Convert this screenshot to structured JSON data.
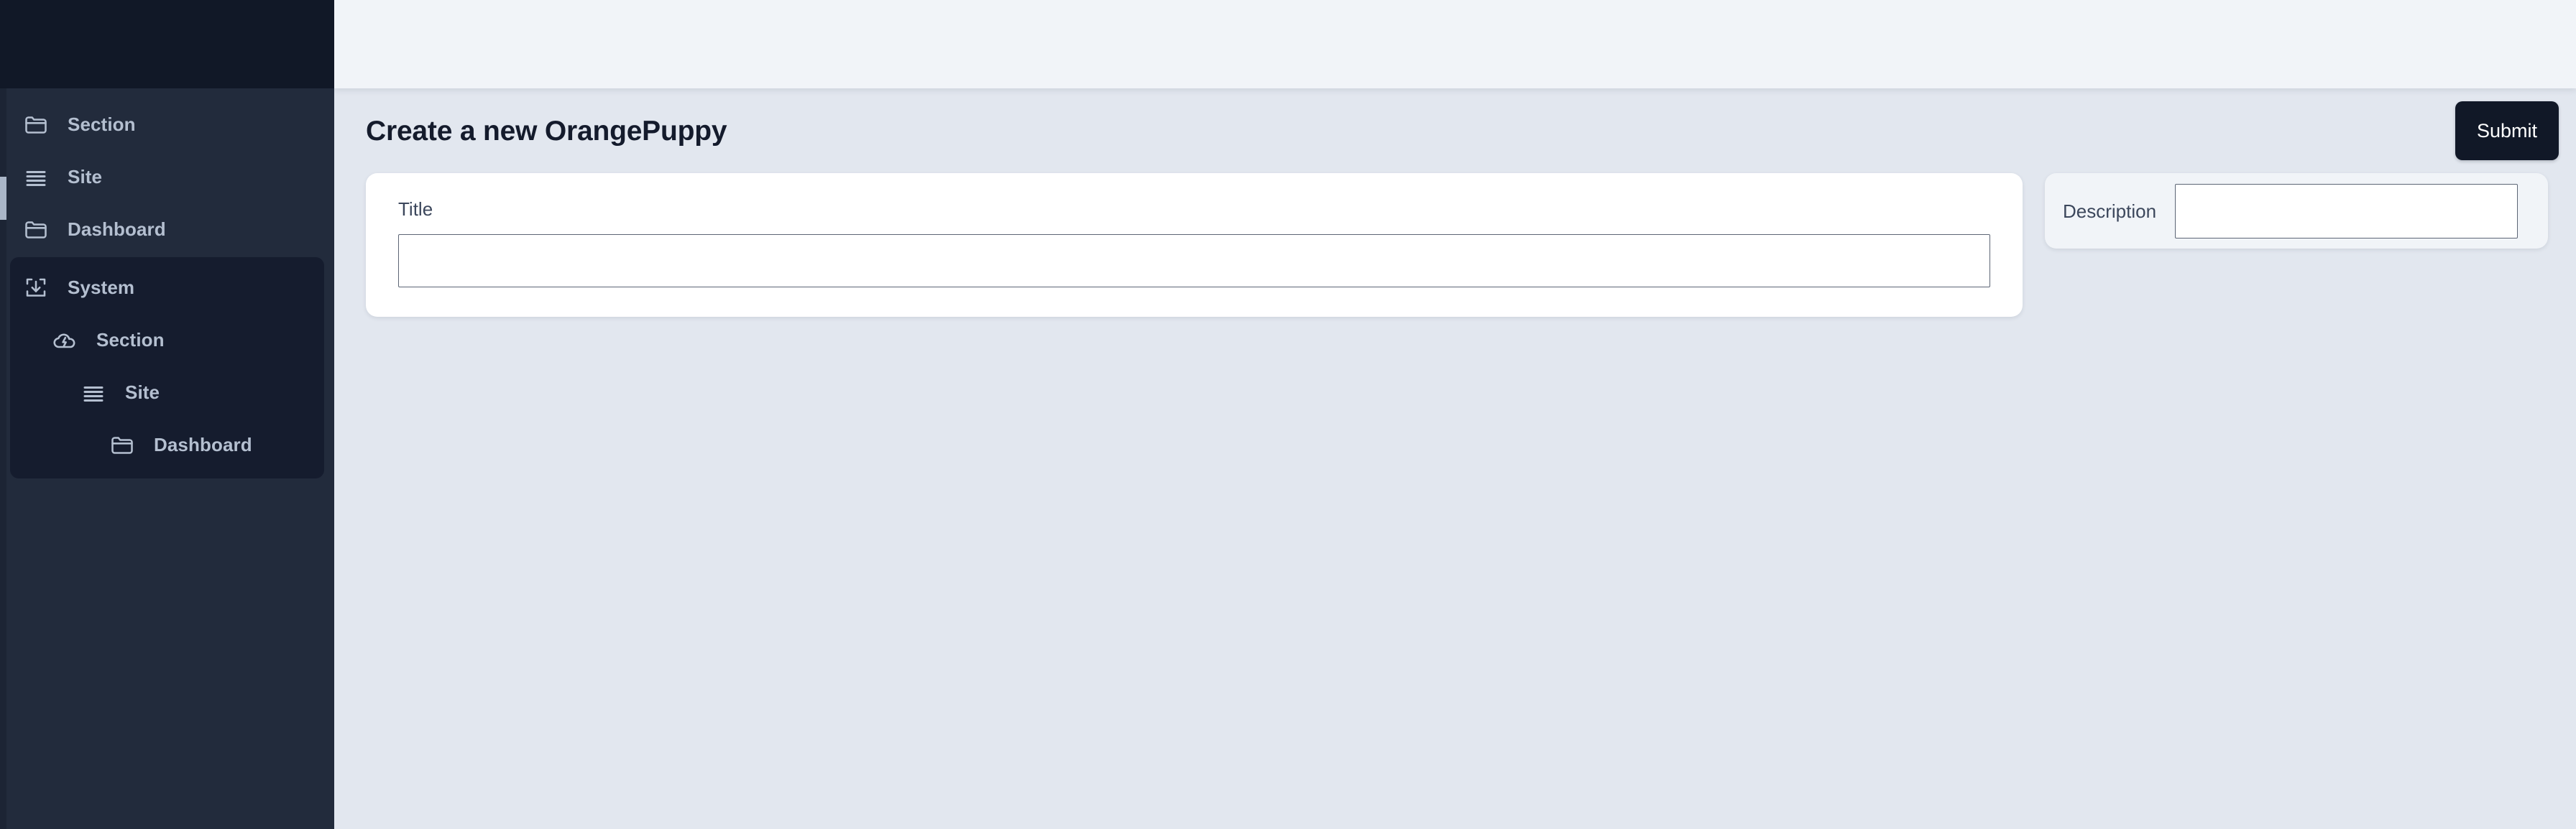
{
  "sidebar": {
    "background_color": "#222b3c",
    "brand_color": "#111827",
    "items": [
      {
        "label": "Section",
        "icon": "folder-icon",
        "indent": 0,
        "group": false
      },
      {
        "label": "Site",
        "icon": "menu-list-icon",
        "indent": 0,
        "group": false
      },
      {
        "label": "Dashboard",
        "icon": "folder-icon",
        "indent": 0,
        "group": false
      }
    ],
    "group": {
      "active": true,
      "background_color": "#151c2e",
      "items": [
        {
          "label": "System",
          "icon": "download-box-icon",
          "indent": 0
        },
        {
          "label": "Section",
          "icon": "cloud-lightning-icon",
          "indent": 1
        },
        {
          "label": "Site",
          "icon": "menu-list-icon",
          "indent": 2
        },
        {
          "label": "Dashboard",
          "icon": "folder-icon",
          "indent": 3
        }
      ]
    }
  },
  "topbar": {
    "background_color": "#f1f4f8"
  },
  "page": {
    "title": "Create a new OrangePuppy",
    "submit_label": "Submit",
    "submit_color": "#111827"
  },
  "form": {
    "title_field": {
      "label": "Title",
      "value": "",
      "placeholder": ""
    },
    "description_field": {
      "label": "Description",
      "value": "",
      "placeholder": ""
    }
  }
}
